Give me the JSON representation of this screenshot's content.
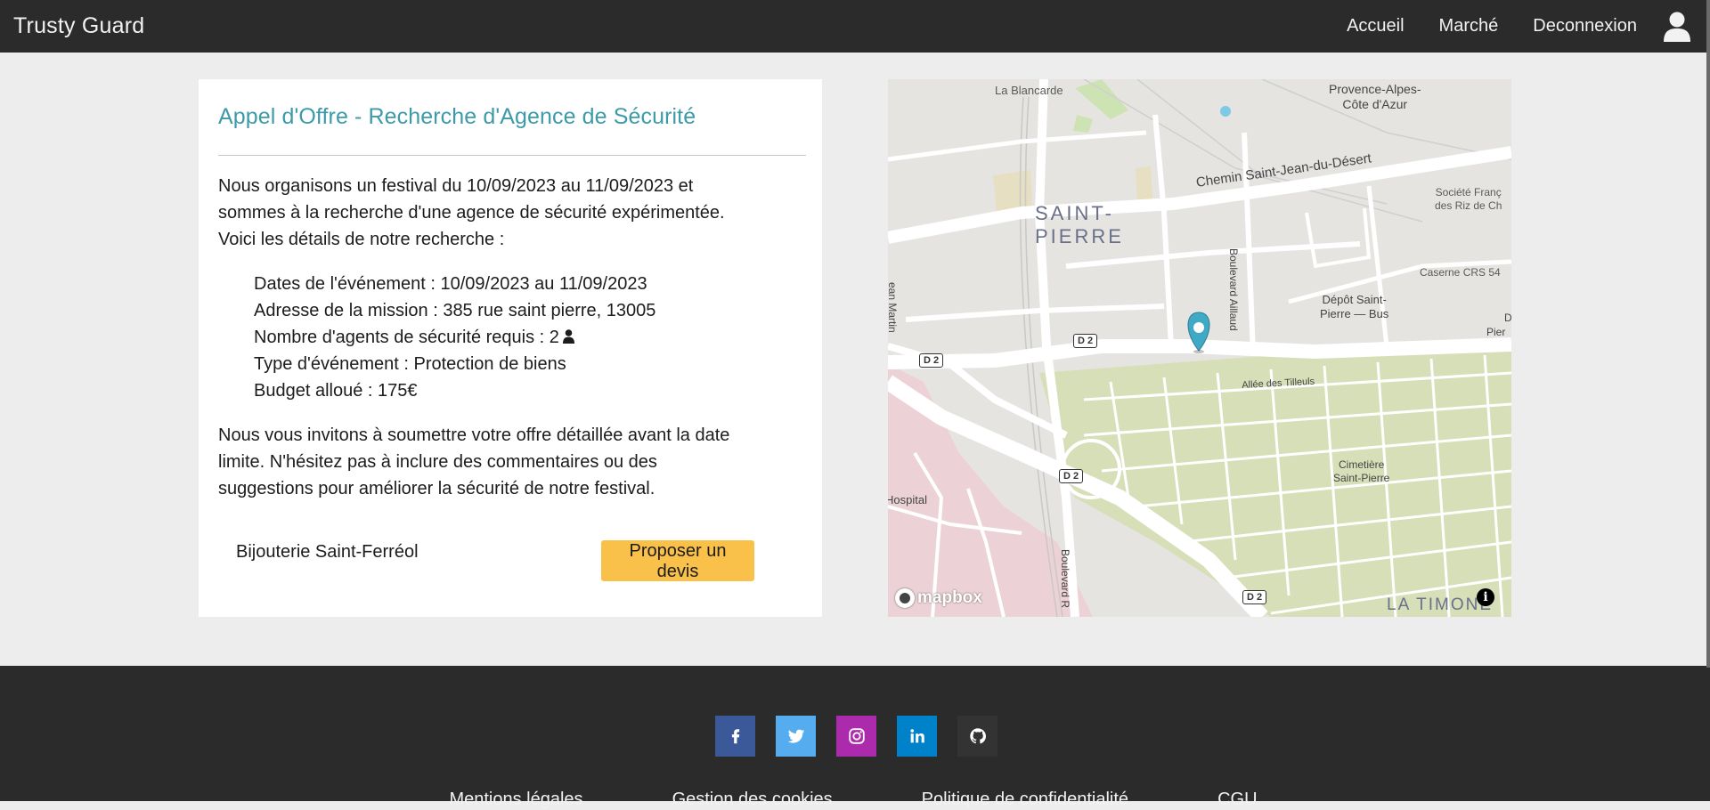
{
  "navbar": {
    "brand": "Trusty Guard",
    "links": [
      "Accueil",
      "Marché",
      "Deconnexion"
    ],
    "user_icon": "user-icon"
  },
  "offer": {
    "title": "Appel d'Offre - Recherche d'Agence de Sécurité",
    "intro_lines": [
      "Nous organisons un festival du 10/09/2023 au 11/09/2023 et",
      "sommes à la recherche d'une agence de sécurité expérimentée.",
      "Voici les détails de notre recherche :"
    ],
    "details": {
      "dates": "Dates de l'événement : 10/09/2023 au 11/09/2023",
      "address": "Adresse de la mission : 385 rue saint pierre, 13005",
      "agents": "Nombre d'agents de sécurité requis : 2",
      "type": "Type d'événement : Protection de biens",
      "budget": "Budget alloué : 175€"
    },
    "outro_lines": [
      "Nous vous invitons à soumettre votre offre détaillée avant la date",
      "limite. N'hésitez pas à inclure des commentaires ou des",
      "suggestions pour améliorer la sécurité de notre festival."
    ],
    "company": "Bijouterie Saint-Ferréol",
    "quote_button": "Proposer un devis"
  },
  "map": {
    "labels": {
      "blancarde": "La Blancarde",
      "paca_1": "Provence-Alpes-",
      "paca_2": "Côte d'Azur",
      "chemin": "Chemin Saint-Jean-du-Désert",
      "societe_1": "Société Franç",
      "societe_2": "des Riz de Ch",
      "saint": "SAINT-",
      "pierre": "PIERRE",
      "caserne": "Caserne CRS 54",
      "depot_1": "Dépôt Saint-",
      "depot_2": "Pierre — Bus",
      "bd_aillaud": "Boulevard Aillaud",
      "martin": "ean Martin",
      "pier": "Pier",
      "d_edge": "D",
      "tilleuls": "Allée des Tilleuls",
      "cimetiere_1": "Cimetière",
      "cimetiere_2": "Saint-Pierre",
      "hospital": "Hospital",
      "bd_bottom": "Boulevard R",
      "timone": "LA TIMONE"
    },
    "road_badges": [
      "D 2",
      "D 2",
      "D 2",
      "D 2"
    ],
    "attribution": "mapbox",
    "info": "i",
    "marker_icon": "map-pin-icon"
  },
  "footer": {
    "socials": [
      {
        "name": "facebook-icon",
        "color": "#3b5998"
      },
      {
        "name": "twitter-icon",
        "color": "#55acee"
      },
      {
        "name": "instagram-icon",
        "color": "#ac2bac"
      },
      {
        "name": "linkedin-icon",
        "color": "#0082ca"
      },
      {
        "name": "github-icon",
        "color": "#333333"
      }
    ],
    "links": [
      "Mentions légales",
      "Gestion des cookies",
      "Politique de confidentialité",
      "CGU"
    ]
  },
  "colors": {
    "navbar_bg": "#2b2b2b",
    "page_bg": "#ededed",
    "title_accent": "#3d9ba8",
    "button_bg": "#f9c14a",
    "map_marker": "#3fa9c6"
  }
}
